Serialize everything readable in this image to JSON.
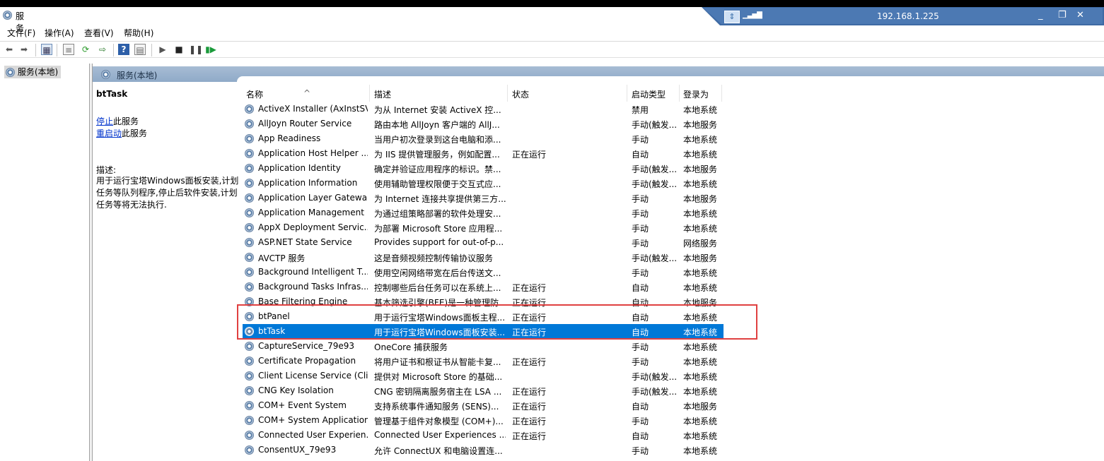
{
  "window": {
    "title": "服务"
  },
  "remote": {
    "address": "192.168.1.225",
    "minimize": "_",
    "restore": "❐",
    "close": "✕"
  },
  "menu": {
    "file": "文件(F)",
    "action": "操作(A)",
    "view": "查看(V)",
    "help": "帮助(H)"
  },
  "tree": {
    "item": "服务(本地)"
  },
  "pane": {
    "header": "服务(本地)"
  },
  "details": {
    "service_name": "btTask",
    "stop_link": "停止",
    "stop_suffix": "此服务",
    "restart_link": "重启动",
    "restart_suffix": "此服务",
    "desc_label": "描述:",
    "desc_text": "用于运行宝塔Windows面板安装,计划任务等队列程序,停止后软件安装,计划任务等将无法执行."
  },
  "columns": {
    "name": "名称",
    "desc": "描述",
    "status": "状态",
    "startup": "启动类型",
    "logon": "登录为"
  },
  "services": [
    {
      "name": "ActiveX Installer (AxInstSV)",
      "desc": "为从 Internet 安装 ActiveX 控...",
      "status": "",
      "startup": "禁用",
      "logon": "本地系统"
    },
    {
      "name": "AllJoyn Router Service",
      "desc": "路由本地 AllJoyn 客户端的 AllJ...",
      "status": "",
      "startup": "手动(触发...",
      "logon": "本地服务"
    },
    {
      "name": "App Readiness",
      "desc": "当用户初次登录到这台电脑和添...",
      "status": "",
      "startup": "手动",
      "logon": "本地系统"
    },
    {
      "name": "Application Host Helper ...",
      "desc": "为 IIS 提供管理服务，例如配置...",
      "status": "正在运行",
      "startup": "自动",
      "logon": "本地系统"
    },
    {
      "name": "Application Identity",
      "desc": "确定并验证应用程序的标识。禁...",
      "status": "",
      "startup": "手动(触发...",
      "logon": "本地服务"
    },
    {
      "name": "Application Information",
      "desc": "使用辅助管理权限便于交互式应...",
      "status": "",
      "startup": "手动(触发...",
      "logon": "本地系统"
    },
    {
      "name": "Application Layer Gatewa...",
      "desc": "为 Internet 连接共享提供第三方...",
      "status": "",
      "startup": "手动",
      "logon": "本地服务"
    },
    {
      "name": "Application Management",
      "desc": "为通过组策略部署的软件处理安...",
      "status": "",
      "startup": "手动",
      "logon": "本地系统"
    },
    {
      "name": "AppX Deployment Servic...",
      "desc": "为部署 Microsoft Store 应用程...",
      "status": "",
      "startup": "手动",
      "logon": "本地系统"
    },
    {
      "name": "ASP.NET State Service",
      "desc": "Provides support for out-of-p...",
      "status": "",
      "startup": "手动",
      "logon": "网络服务"
    },
    {
      "name": "AVCTP 服务",
      "desc": "这是音频视频控制传输协议服务",
      "status": "",
      "startup": "手动(触发...",
      "logon": "本地服务"
    },
    {
      "name": "Background Intelligent T...",
      "desc": "使用空闲网络带宽在后台传送文...",
      "status": "",
      "startup": "手动",
      "logon": "本地系统"
    },
    {
      "name": "Background Tasks Infras...",
      "desc": "控制哪些后台任务可以在系统上...",
      "status": "正在运行",
      "startup": "自动",
      "logon": "本地系统"
    },
    {
      "name": "Base Filtering Engine",
      "desc": "基本筛选引擎(BFE)是一种管理防...",
      "status": "正在运行",
      "startup": "自动",
      "logon": "本地服务"
    },
    {
      "name": "btPanel",
      "desc": "用于运行宝塔Windows面板主程...",
      "status": "正在运行",
      "startup": "自动",
      "logon": "本地系统"
    },
    {
      "name": "btTask",
      "desc": "用于运行宝塔Windows面板安装...",
      "status": "正在运行",
      "startup": "自动",
      "logon": "本地系统"
    },
    {
      "name": "CaptureService_79e93",
      "desc": "OneCore 捕获服务",
      "status": "",
      "startup": "手动",
      "logon": "本地系统"
    },
    {
      "name": "Certificate Propagation",
      "desc": "将用户证书和根证书从智能卡复...",
      "status": "正在运行",
      "startup": "手动",
      "logon": "本地系统"
    },
    {
      "name": "Client License Service (Cli...",
      "desc": "提供对 Microsoft Store 的基础...",
      "status": "",
      "startup": "手动(触发...",
      "logon": "本地系统"
    },
    {
      "name": "CNG Key Isolation",
      "desc": "CNG 密钥隔离服务宿主在 LSA ...",
      "status": "正在运行",
      "startup": "手动(触发...",
      "logon": "本地系统"
    },
    {
      "name": "COM+ Event System",
      "desc": "支持系统事件通知服务 (SENS)...",
      "status": "正在运行",
      "startup": "自动",
      "logon": "本地服务"
    },
    {
      "name": "COM+ System Application",
      "desc": "管理基于组件对象模型 (COM+)...",
      "status": "正在运行",
      "startup": "手动",
      "logon": "本地系统"
    },
    {
      "name": "Connected User Experien...",
      "desc": "Connected User Experiences ...",
      "status": "正在运行",
      "startup": "自动",
      "logon": "本地系统"
    },
    {
      "name": "ConsentUX_79e93",
      "desc": "允许 ConnectUX 和电脑设置连...",
      "status": "",
      "startup": "手动",
      "logon": "本地系统"
    }
  ],
  "selected_index": 15,
  "colors": {
    "selection": "#0078d7",
    "highlight_box": "#e04040",
    "header": "#97b1cd"
  }
}
